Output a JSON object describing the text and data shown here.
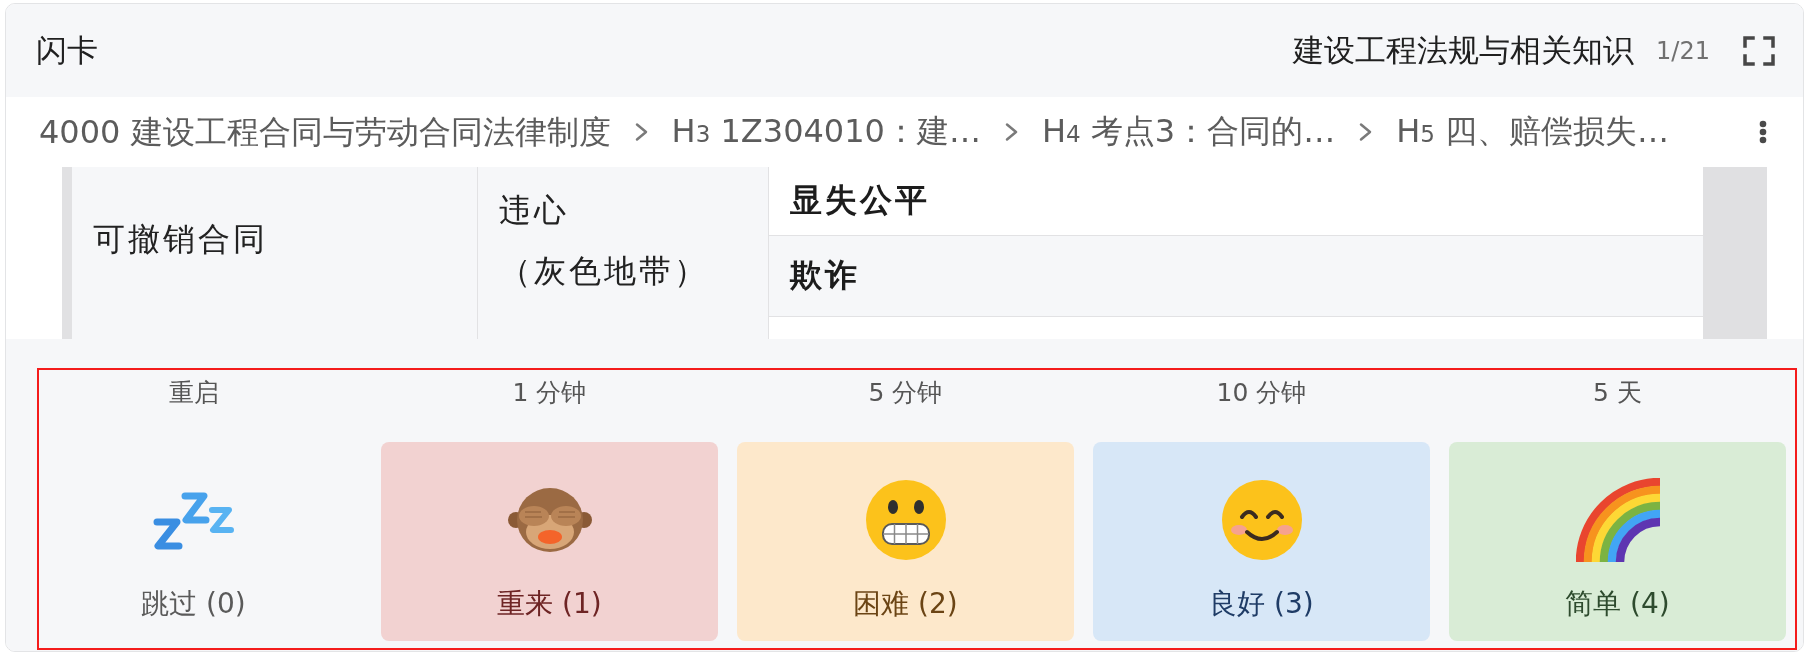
{
  "header": {
    "title": "闪卡",
    "deck": "建设工程法规与相关知识",
    "counter": "1/21"
  },
  "breadcrumb": {
    "items": [
      {
        "text": "4000 建设工程合同与劳动合同法律制度"
      },
      {
        "text": "H$_{3}$ 1Z304010：建…"
      },
      {
        "text": "H$_{4}$ 考点3：合同的…"
      },
      {
        "text": "H$_{5}$ 四、赔偿损失…"
      }
    ]
  },
  "table": {
    "rows": [
      {
        "column_1": "可撤销合同",
        "column_2": [
          "违心",
          "（灰色地带）"
        ],
        "column_3": [
          "显失公平",
          "欺诈"
        ]
      }
    ]
  },
  "rating": {
    "highlighted": true,
    "buttons": [
      {
        "kind": "skip",
        "interval": "重启",
        "label": "跳过 (0)"
      },
      {
        "kind": "again",
        "interval": "1 分钟",
        "label": "重来 (1)"
      },
      {
        "kind": "hard",
        "interval": "5 分钟",
        "label": "困难 (2)"
      },
      {
        "kind": "good",
        "interval": "10 分钟",
        "label": "良好 (3)"
      },
      {
        "kind": "easy",
        "interval": "5 天",
        "label": "简单 (4)"
      }
    ]
  }
}
